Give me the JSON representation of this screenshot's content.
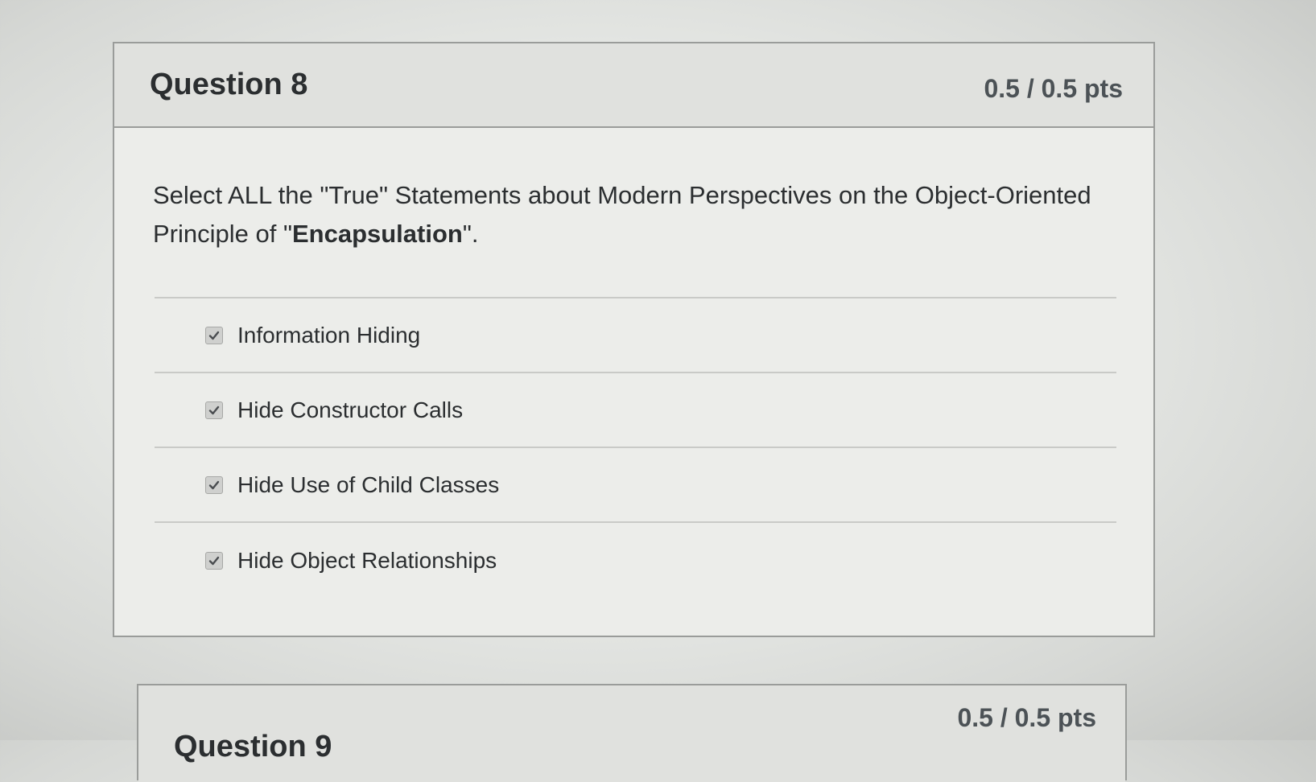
{
  "question8": {
    "title": "Question 8",
    "points": "0.5 / 0.5 pts",
    "prompt_part1": "Select ALL the \"True\" Statements about Modern Perspectives on the Object-Oriented Principle of \"",
    "prompt_bold": "Encapsulation",
    "prompt_part2": "\".",
    "answers": [
      {
        "label": "Information Hiding",
        "checked": true
      },
      {
        "label": "Hide Constructor Calls",
        "checked": true
      },
      {
        "label": "Hide Use of Child Classes",
        "checked": true
      },
      {
        "label": "Hide Object Relationships",
        "checked": true
      }
    ]
  },
  "question9": {
    "title": "Question 9",
    "points": "0.5 / 0.5 pts"
  }
}
